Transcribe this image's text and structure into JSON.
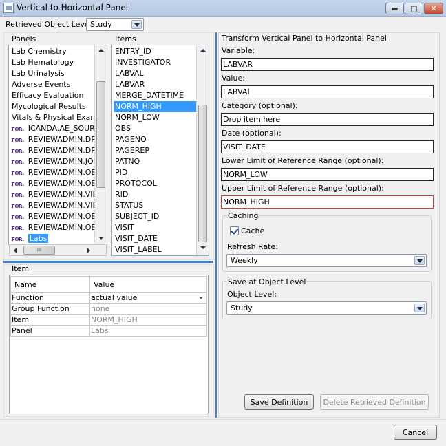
{
  "window": {
    "title": "Vertical to Horizontal Panel",
    "minimize": "▬",
    "maximize": "□",
    "close": "✕"
  },
  "top": {
    "retrieved_label": "Retrieved Object Level:",
    "retrieved_value": "Study"
  },
  "panels": {
    "header": "Panels",
    "items": [
      {
        "label": "Lab Chemistry",
        "tag": ""
      },
      {
        "label": "Lab Hematology",
        "tag": ""
      },
      {
        "label": "Lab Urinalysis",
        "tag": ""
      },
      {
        "label": "Adverse Events",
        "tag": ""
      },
      {
        "label": "Efficacy Evaluation",
        "tag": ""
      },
      {
        "label": "Mycological Results",
        "tag": ""
      },
      {
        "label": "Vitals & Physical Exam",
        "tag": ""
      },
      {
        "label": "ICANDA.AE_SOURCE",
        "tag": "FOR."
      },
      {
        "label": "REVIEWADMIN.DRPA",
        "tag": "FOR."
      },
      {
        "label": "REVIEWADMIN.DRSE",
        "tag": "FOR."
      },
      {
        "label": "REVIEWADMIN.JOBS",
        "tag": "FOR."
      },
      {
        "label": "REVIEWADMIN.OBJE",
        "tag": "FOR."
      },
      {
        "label": "REVIEWADMIN.OBJE",
        "tag": "FOR."
      },
      {
        "label": "REVIEWADMIN.VIEW",
        "tag": "FOR."
      },
      {
        "label": "REVIEWADMIN.VIEW",
        "tag": "FOR."
      },
      {
        "label": "REVIEWADMIN.OBJE",
        "tag": "FOR."
      },
      {
        "label": "REVIEWADMIN.OBJE",
        "tag": "FOR."
      },
      {
        "label": "Labs",
        "tag": "FOR.",
        "selected": true
      }
    ],
    "hscroll_grip": "III"
  },
  "items": {
    "header": "Items",
    "list": [
      "ENTRY_ID",
      "INVESTIGATOR",
      "LABVAL",
      "LABVAR",
      "MERGE_DATETIME",
      "NORM_HIGH",
      "NORM_LOW",
      "OBS",
      "PAGENO",
      "PAGEREP",
      "PATNO",
      "PID",
      "PROTOCOL",
      "RID",
      "STATUS",
      "SUBJECT_ID",
      "VISIT",
      "VISIT_DATE",
      "VISIT_LABEL"
    ],
    "selected_index": 5
  },
  "item_props": {
    "header": "Item",
    "columns": [
      "Name",
      "Value"
    ],
    "rows": [
      {
        "name": "Function",
        "value": "actual value"
      },
      {
        "name": "Group Function",
        "value": "none"
      },
      {
        "name": "Item",
        "value": "NORM_HIGH"
      },
      {
        "name": "Panel",
        "value": "Labs"
      }
    ]
  },
  "transform": {
    "header": "Transform Vertical Panel to Horizontal Panel",
    "fields": [
      {
        "label": "Variable:",
        "value": "LABVAR"
      },
      {
        "label": "Value:",
        "value": "LABVAL"
      },
      {
        "label": "Category (optional):",
        "value": "Drop item here"
      },
      {
        "label": "Date (optional):",
        "value": "VISIT_DATE"
      },
      {
        "label": "Lower Limit of Reference Range (optional):",
        "value": "NORM_LOW"
      },
      {
        "label": "Upper Limit of Reference Range (optional):",
        "value": "NORM_HIGH"
      }
    ],
    "caching": {
      "header": "Caching",
      "cache_label": "Cache",
      "cache_checked": true,
      "refresh_label": "Refresh Rate:",
      "refresh_value": "Weekly"
    },
    "save_level": {
      "header": "Save at Object Level",
      "object_label": "Object Level:",
      "object_value": "Study"
    },
    "save_button": "Save Definition",
    "delete_button": "Delete Retrieved Definition"
  },
  "footer": {
    "cancel": "Cancel"
  }
}
